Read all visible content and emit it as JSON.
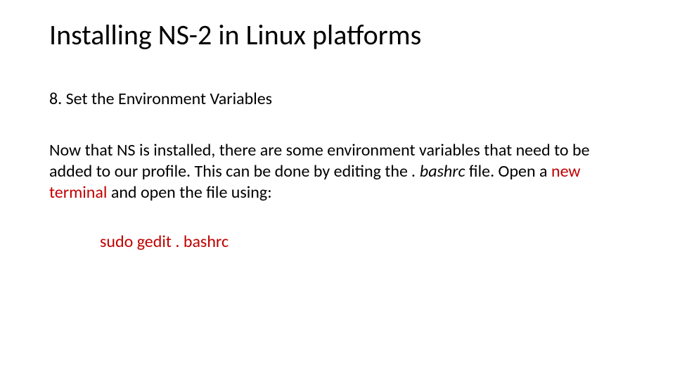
{
  "slide": {
    "title": "Installing NS-2 in Linux platforms",
    "step_heading": "8. Set the Environment Variables",
    "body": {
      "part1": "Now that NS is installed, there are some environment variables that need to be added to our profile. This can be done by editing the",
      "bashrc_label": ". bashrc",
      "part2": "file. Open a",
      "new_terminal": "new terminal",
      "part3": "and open the file using:"
    },
    "command": {
      "prefix": "sudo",
      "tool": "gedit",
      "file": ". bashrc"
    }
  }
}
